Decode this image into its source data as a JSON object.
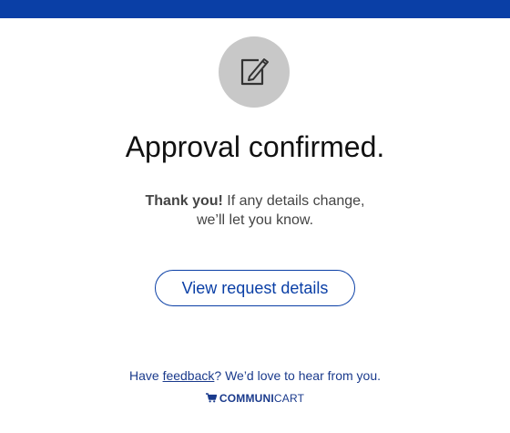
{
  "header": {
    "bar_color": "#0a3fa6"
  },
  "hero": {
    "icon": "edit-icon",
    "circle_color": "#c8c8c8"
  },
  "title": "Approval confirmed.",
  "message": {
    "bold": "Thank you!",
    "line1_rest": " If any details change,",
    "line2": "we’ll let you know."
  },
  "cta": {
    "label": "View request details"
  },
  "footer": {
    "prefix": "Have ",
    "link": "feedback",
    "suffix": "? We’d love to hear from you.",
    "brand_bold": "COMMUNI",
    "brand_light": "CART",
    "brand_icon": "shopping-cart-icon"
  }
}
